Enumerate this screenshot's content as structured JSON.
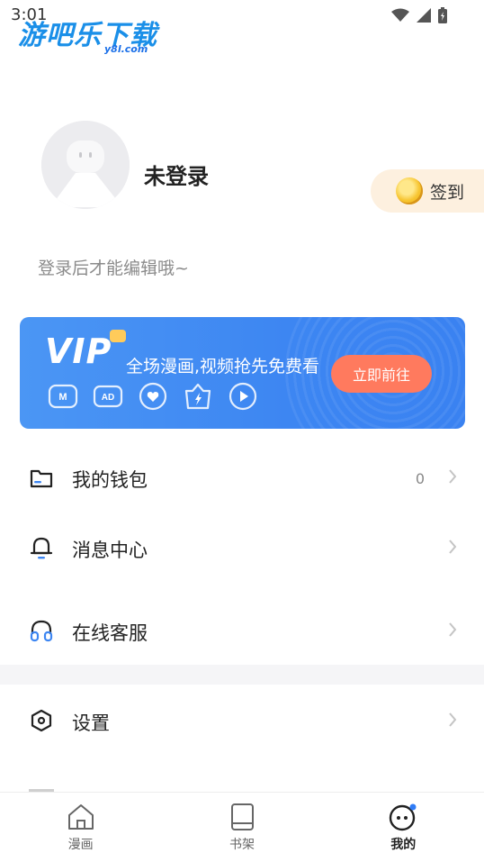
{
  "status_bar": {
    "time": "3:01"
  },
  "watermark": {
    "title": "游吧乐下载",
    "subtitle": "y8l.com"
  },
  "profile": {
    "username": "未登录",
    "hint": "登录后才能编辑哦~",
    "checkin_label": "签到"
  },
  "vip": {
    "logo": "VIP",
    "slogan": "全场漫画,视频抢先免费看",
    "button": "立即前往",
    "icons": [
      "manga-icon",
      "ad-free-icon",
      "heart-icon",
      "bolt-icon",
      "play-icon"
    ]
  },
  "menu": [
    {
      "label": "我的钱包",
      "value": "0",
      "icon": "wallet-icon"
    },
    {
      "label": "消息中心",
      "value": "",
      "icon": "bell-icon"
    },
    {
      "label": "在线客服",
      "value": "",
      "icon": "headset-icon"
    },
    {
      "label": "设置",
      "value": "",
      "icon": "settings-icon"
    }
  ],
  "tabs": [
    {
      "label": "漫画",
      "icon": "home-icon",
      "active": false
    },
    {
      "label": "书架",
      "icon": "book-icon",
      "active": false
    },
    {
      "label": "我的",
      "icon": "profile-icon",
      "active": true
    }
  ],
  "colors": {
    "accent": "#3d86f2",
    "vip_button": "#ff7a5e",
    "checkin_bg": "#fdf0df",
    "notification_dot": "#2f7cf6"
  }
}
